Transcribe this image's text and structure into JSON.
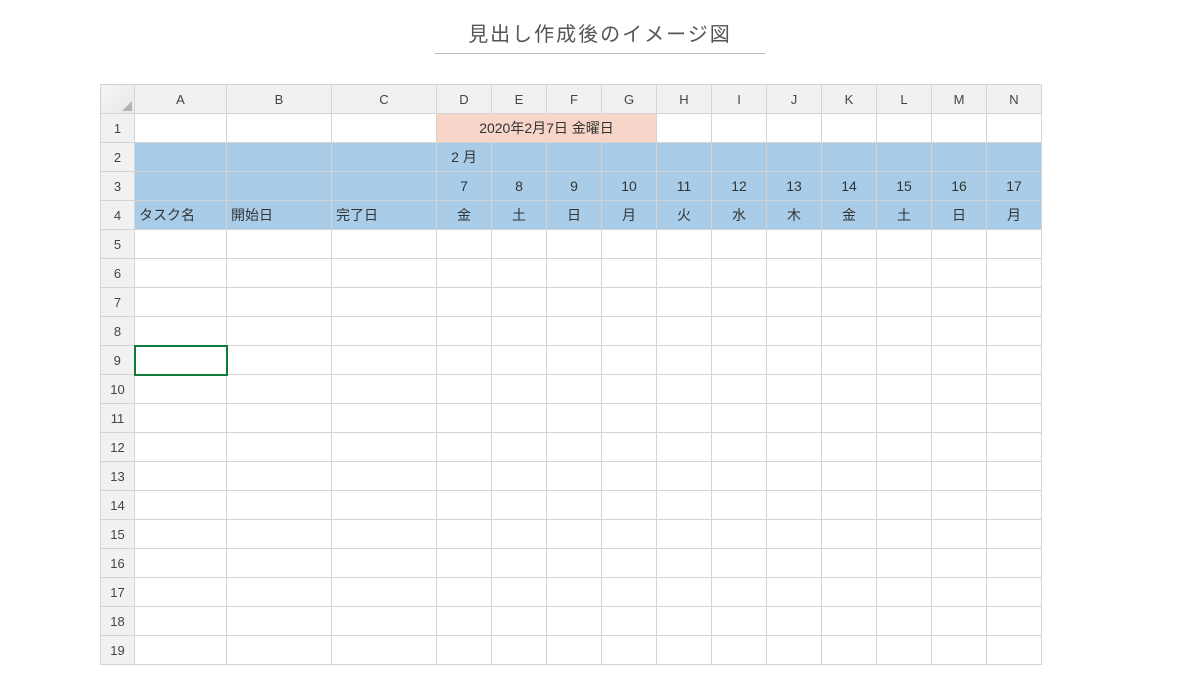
{
  "title": "見出し作成後のイメージ図",
  "columns": [
    "A",
    "B",
    "C",
    "D",
    "E",
    "F",
    "G",
    "H",
    "I",
    "J",
    "K",
    "L",
    "M",
    "N"
  ],
  "rows": [
    "1",
    "2",
    "3",
    "4",
    "5",
    "6",
    "7",
    "8",
    "9",
    "10",
    "11",
    "12",
    "13",
    "14",
    "15",
    "16",
    "17",
    "18",
    "19"
  ],
  "dateLabel": "2020年2月7日 金曜日",
  "monthLabel": "2 月",
  "dayNumbers": [
    "7",
    "8",
    "9",
    "10",
    "11",
    "12",
    "13",
    "14",
    "15",
    "16",
    "17"
  ],
  "weekdays": [
    "金",
    "土",
    "日",
    "月",
    "火",
    "水",
    "木",
    "金",
    "土",
    "日",
    "月"
  ],
  "headers": {
    "task": "タスク名",
    "start": "開始日",
    "end": "完了日"
  },
  "selectedRow": "9"
}
